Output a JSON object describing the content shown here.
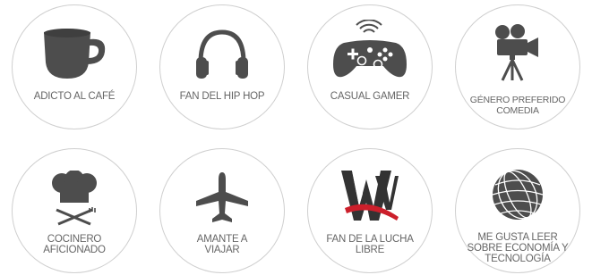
{
  "badges": [
    {
      "icon": "coffee-cup-icon",
      "label": "ADICTO AL CAFÉ"
    },
    {
      "icon": "headphones-icon",
      "label": "FAN DEL HIP HOP"
    },
    {
      "icon": "game-controller-icon",
      "label": "CASUAL GAMER"
    },
    {
      "icon": "film-camera-icon",
      "label": "GÉNERO PREFERIDO COMEDIA"
    },
    {
      "icon": "chef-hat-icon",
      "label": "COCINERO AFICIONADO"
    },
    {
      "icon": "airplane-icon",
      "label": "AMANTE A VIAJAR"
    },
    {
      "icon": "wwe-logo-icon",
      "label": "FAN DE LA LUCHA LIBRE"
    },
    {
      "icon": "globe-icon",
      "label": "ME GUSTA LEER SOBRE ECONOMÍA Y TECNOLOGÍA"
    }
  ],
  "colors": {
    "icon": "#4d4d4d",
    "border": "#cfcfcf",
    "text": "#666666",
    "accent": "#cc1f2b"
  }
}
